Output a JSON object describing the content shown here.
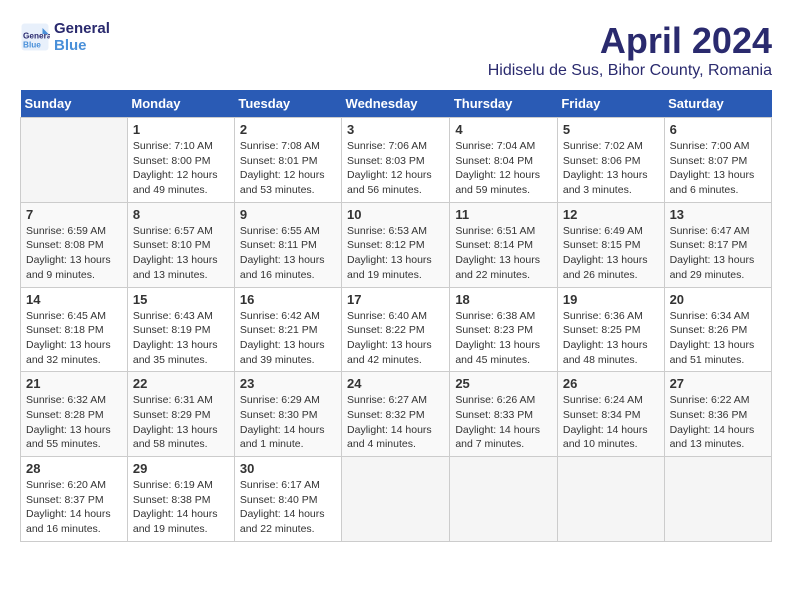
{
  "header": {
    "logo_line1": "General",
    "logo_line2": "Blue",
    "title": "April 2024",
    "subtitle": "Hidiselu de Sus, Bihor County, Romania"
  },
  "calendar": {
    "days_of_week": [
      "Sunday",
      "Monday",
      "Tuesday",
      "Wednesday",
      "Thursday",
      "Friday",
      "Saturday"
    ],
    "weeks": [
      [
        {
          "day": "",
          "info": ""
        },
        {
          "day": "1",
          "info": "Sunrise: 7:10 AM\nSunset: 8:00 PM\nDaylight: 12 hours\nand 49 minutes."
        },
        {
          "day": "2",
          "info": "Sunrise: 7:08 AM\nSunset: 8:01 PM\nDaylight: 12 hours\nand 53 minutes."
        },
        {
          "day": "3",
          "info": "Sunrise: 7:06 AM\nSunset: 8:03 PM\nDaylight: 12 hours\nand 56 minutes."
        },
        {
          "day": "4",
          "info": "Sunrise: 7:04 AM\nSunset: 8:04 PM\nDaylight: 12 hours\nand 59 minutes."
        },
        {
          "day": "5",
          "info": "Sunrise: 7:02 AM\nSunset: 8:06 PM\nDaylight: 13 hours\nand 3 minutes."
        },
        {
          "day": "6",
          "info": "Sunrise: 7:00 AM\nSunset: 8:07 PM\nDaylight: 13 hours\nand 6 minutes."
        }
      ],
      [
        {
          "day": "7",
          "info": "Sunrise: 6:59 AM\nSunset: 8:08 PM\nDaylight: 13 hours\nand 9 minutes."
        },
        {
          "day": "8",
          "info": "Sunrise: 6:57 AM\nSunset: 8:10 PM\nDaylight: 13 hours\nand 13 minutes."
        },
        {
          "day": "9",
          "info": "Sunrise: 6:55 AM\nSunset: 8:11 PM\nDaylight: 13 hours\nand 16 minutes."
        },
        {
          "day": "10",
          "info": "Sunrise: 6:53 AM\nSunset: 8:12 PM\nDaylight: 13 hours\nand 19 minutes."
        },
        {
          "day": "11",
          "info": "Sunrise: 6:51 AM\nSunset: 8:14 PM\nDaylight: 13 hours\nand 22 minutes."
        },
        {
          "day": "12",
          "info": "Sunrise: 6:49 AM\nSunset: 8:15 PM\nDaylight: 13 hours\nand 26 minutes."
        },
        {
          "day": "13",
          "info": "Sunrise: 6:47 AM\nSunset: 8:17 PM\nDaylight: 13 hours\nand 29 minutes."
        }
      ],
      [
        {
          "day": "14",
          "info": "Sunrise: 6:45 AM\nSunset: 8:18 PM\nDaylight: 13 hours\nand 32 minutes."
        },
        {
          "day": "15",
          "info": "Sunrise: 6:43 AM\nSunset: 8:19 PM\nDaylight: 13 hours\nand 35 minutes."
        },
        {
          "day": "16",
          "info": "Sunrise: 6:42 AM\nSunset: 8:21 PM\nDaylight: 13 hours\nand 39 minutes."
        },
        {
          "day": "17",
          "info": "Sunrise: 6:40 AM\nSunset: 8:22 PM\nDaylight: 13 hours\nand 42 minutes."
        },
        {
          "day": "18",
          "info": "Sunrise: 6:38 AM\nSunset: 8:23 PM\nDaylight: 13 hours\nand 45 minutes."
        },
        {
          "day": "19",
          "info": "Sunrise: 6:36 AM\nSunset: 8:25 PM\nDaylight: 13 hours\nand 48 minutes."
        },
        {
          "day": "20",
          "info": "Sunrise: 6:34 AM\nSunset: 8:26 PM\nDaylight: 13 hours\nand 51 minutes."
        }
      ],
      [
        {
          "day": "21",
          "info": "Sunrise: 6:32 AM\nSunset: 8:28 PM\nDaylight: 13 hours\nand 55 minutes."
        },
        {
          "day": "22",
          "info": "Sunrise: 6:31 AM\nSunset: 8:29 PM\nDaylight: 13 hours\nand 58 minutes."
        },
        {
          "day": "23",
          "info": "Sunrise: 6:29 AM\nSunset: 8:30 PM\nDaylight: 14 hours\nand 1 minute."
        },
        {
          "day": "24",
          "info": "Sunrise: 6:27 AM\nSunset: 8:32 PM\nDaylight: 14 hours\nand 4 minutes."
        },
        {
          "day": "25",
          "info": "Sunrise: 6:26 AM\nSunset: 8:33 PM\nDaylight: 14 hours\nand 7 minutes."
        },
        {
          "day": "26",
          "info": "Sunrise: 6:24 AM\nSunset: 8:34 PM\nDaylight: 14 hours\nand 10 minutes."
        },
        {
          "day": "27",
          "info": "Sunrise: 6:22 AM\nSunset: 8:36 PM\nDaylight: 14 hours\nand 13 minutes."
        }
      ],
      [
        {
          "day": "28",
          "info": "Sunrise: 6:20 AM\nSunset: 8:37 PM\nDaylight: 14 hours\nand 16 minutes."
        },
        {
          "day": "29",
          "info": "Sunrise: 6:19 AM\nSunset: 8:38 PM\nDaylight: 14 hours\nand 19 minutes."
        },
        {
          "day": "30",
          "info": "Sunrise: 6:17 AM\nSunset: 8:40 PM\nDaylight: 14 hours\nand 22 minutes."
        },
        {
          "day": "",
          "info": ""
        },
        {
          "day": "",
          "info": ""
        },
        {
          "day": "",
          "info": ""
        },
        {
          "day": "",
          "info": ""
        }
      ]
    ]
  }
}
